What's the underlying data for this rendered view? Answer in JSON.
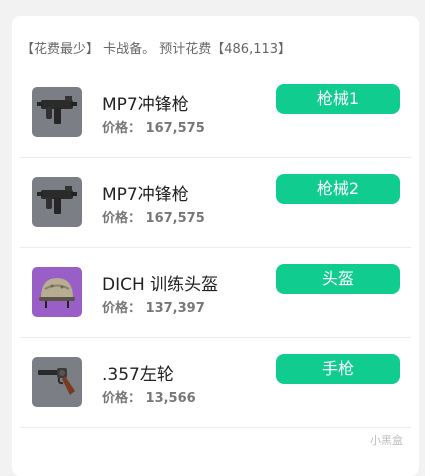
{
  "summary": "【花费最少】 卡战备。 预计花费【486,113】",
  "items": [
    {
      "name": "MP7冲锋枪",
      "price": "价格： 167,575",
      "tag": "枪械1",
      "icon": "smg-icon"
    },
    {
      "name": "MP7冲锋枪",
      "price": "价格： 167,575",
      "tag": "枪械2",
      "icon": "smg-icon"
    },
    {
      "name": "DICH 训练头盔",
      "price": "价格： 137,397",
      "tag": "头盔",
      "icon": "helmet-icon"
    },
    {
      "name": ".357左轮",
      "price": "价格： 13,566",
      "tag": "手枪",
      "icon": "revolver-icon"
    }
  ],
  "watermark": "小黑盒",
  "colors": {
    "tag_bg": "#10cc8e",
    "helmet_bg": "#9a5ec7",
    "thumb_bg": "#7b7e84"
  }
}
